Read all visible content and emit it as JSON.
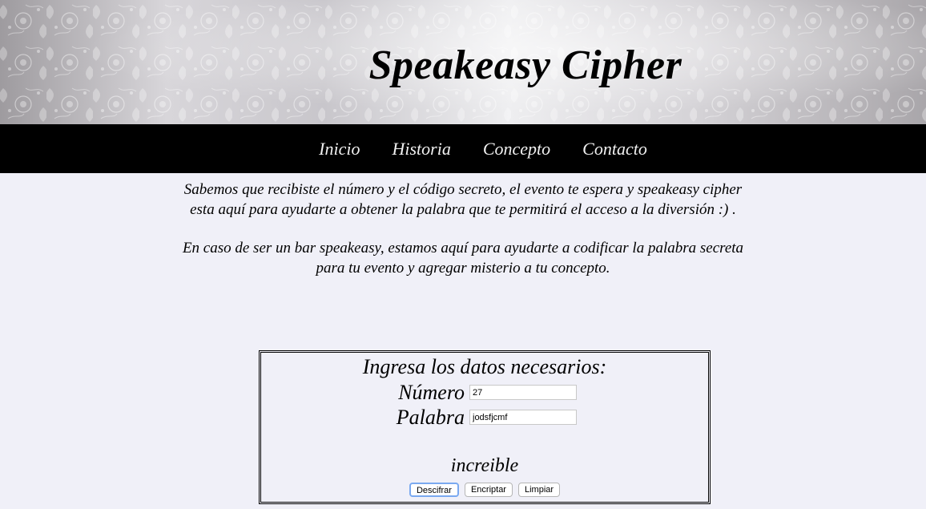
{
  "site": {
    "title": "Speakeasy Cipher"
  },
  "nav": {
    "items": [
      "Inicio",
      "Historia",
      "Concepto",
      "Contacto"
    ]
  },
  "intro": {
    "p1": "Sabemos que recibiste el número y el código secreto, el evento te espera y speakeasy cipher esta aquí para ayudarte a obtener la palabra que te permitirá el acceso a la diversión :) .",
    "p2": "En caso de ser un bar speakeasy, estamos aquí para ayudarte a codificar la palabra secreta para tu evento y agregar misterio a tu concepto."
  },
  "form": {
    "title": "Ingresa los datos necesarios:",
    "numero_label": "Número",
    "numero_value": "27",
    "palabra_label": "Palabra",
    "palabra_value": "jodsfjcmf",
    "result": "increible",
    "buttons": {
      "decrypt": "Descifrar",
      "encrypt": "Encriptar",
      "clear": "Limpiar"
    }
  }
}
